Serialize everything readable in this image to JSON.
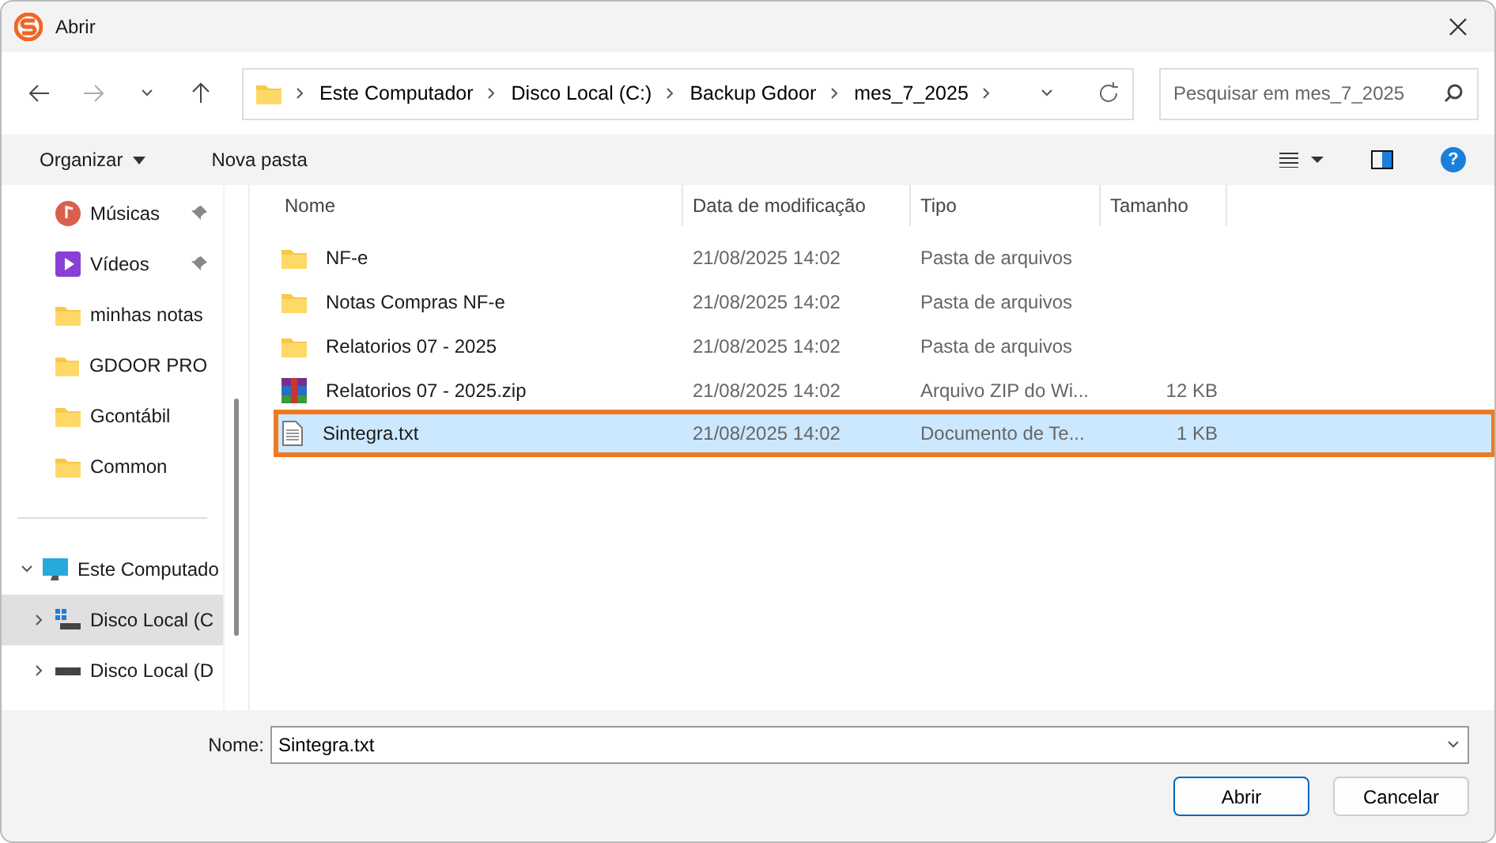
{
  "window": {
    "title": "Abrir"
  },
  "breadcrumb": [
    "Este Computador",
    "Disco Local (C:)",
    "Backup Gdoor",
    "mes_7_2025"
  ],
  "search": {
    "placeholder": "Pesquisar em mes_7_2025"
  },
  "help": "?",
  "commands": [
    {
      "label": "Organizar",
      "kind": "menu"
    },
    {
      "label": "Nova pasta",
      "kind": "plain"
    }
  ],
  "sidebar": {
    "quick": [
      {
        "label": "Músicas",
        "kind": "music",
        "pinned": true
      },
      {
        "label": "Vídeos",
        "kind": "video",
        "pinned": true
      },
      {
        "label": "minhas notas",
        "kind": "folder",
        "pinned": false
      },
      {
        "label": "GDOOR PRO",
        "kind": "folder",
        "pinned": false
      },
      {
        "label": "Gcontábil",
        "kind": "folder",
        "pinned": false
      },
      {
        "label": "Common",
        "kind": "folder",
        "pinned": false
      }
    ],
    "computer": {
      "label": "Este Computado",
      "expanded": true,
      "children": [
        {
          "label": "Disco Local (C",
          "kind": "system",
          "selected": true
        },
        {
          "label": "Disco Local (D",
          "kind": "drive",
          "selected": false
        }
      ]
    }
  },
  "table": {
    "columns": [
      "Nome",
      "Data de modificação",
      "Tipo",
      "Tamanho"
    ],
    "rows": [
      {
        "name": "NF-e",
        "date": "21/08/2025 14:02",
        "type": "Pasta de arquivos",
        "kind": "folder",
        "selected": false,
        "highlighted": false
      },
      {
        "name": "Notas Compras NF-e",
        "date": "21/08/2025 14:02",
        "type": "Pasta de arquivos",
        "kind": "folder",
        "selected": false,
        "highlighted": false
      },
      {
        "name": "Relatorios 07 - 2025",
        "date": "21/08/2025 14:02",
        "type": "Pasta de arquivos",
        "kind": "folder",
        "selected": false,
        "highlighted": false
      },
      {
        "name": "Relatorios 07 - 2025.zip",
        "date": "21/08/2025 14:02",
        "type": "Arquivo ZIP do Wi...",
        "size": "12 KB",
        "kind": "zip",
        "selected": false,
        "highlighted": false
      },
      {
        "name": "Sintegra.txt",
        "date": "21/08/2025 14:02",
        "type": "Documento de Te...",
        "size": "1 KB",
        "kind": "text",
        "selected": true,
        "highlighted": true
      }
    ]
  },
  "filename": {
    "label": "Nome:",
    "value": "Sintegra.txt"
  },
  "buttons": [
    {
      "label": "Abrir",
      "primary": true
    },
    {
      "label": "Cancelar",
      "primary": false
    }
  ]
}
